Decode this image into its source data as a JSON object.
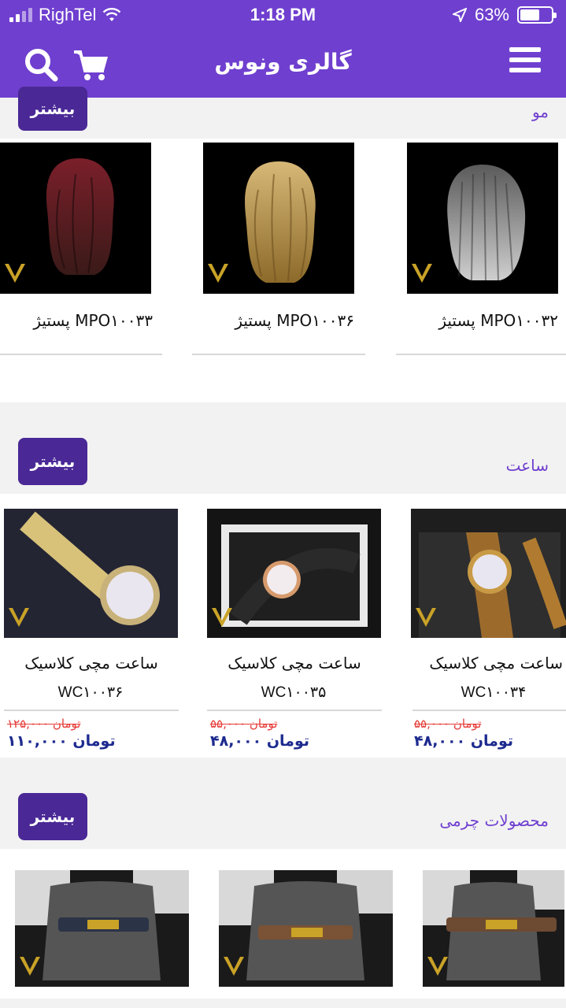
{
  "status_bar": {
    "carrier": "RighTel",
    "time": "1:18 PM",
    "battery": "63%",
    "battery_level": 0.63
  },
  "header": {
    "title": "گالری ونوس"
  },
  "sections": [
    {
      "title": "مو",
      "more_label": "بیشتر",
      "products": [
        {
          "name": "پستیژ   MPO۱۰۰۳۲"
        },
        {
          "name": "پستیژ   MPO۱۰۰۳۶"
        },
        {
          "name": "پستیژ   MPO۱۰۰۳۳"
        }
      ]
    },
    {
      "title": "ساعت",
      "more_label": "بیشتر",
      "products": [
        {
          "name": "ساعت مچی کلاسیک",
          "code": "WC۱۰۰۳۴",
          "old_price": "۵۵,۰۰۰ تومان",
          "price": "۴۸,۰۰۰ تومان"
        },
        {
          "name": "ساعت مچی کلاسیک",
          "code": "WC۱۰۰۳۵",
          "old_price": "۵۵,۰۰۰ تومان",
          "price": "۴۸,۰۰۰ تومان"
        },
        {
          "name": "ساعت مچی کلاسیک",
          "code": "WC۱۰۰۳۶",
          "old_price": "۱۲۵,۰۰۰ تومان",
          "price": "۱۱۰,۰۰۰ تومان"
        }
      ]
    },
    {
      "title": "محصولات چرمی",
      "more_label": "بیشتر",
      "products": [
        {},
        {},
        {}
      ]
    }
  ],
  "colors": {
    "primary": "#6f3fcf",
    "button": "#4a2896",
    "old_price": "#e53935",
    "price": "#1d2a8f"
  },
  "icons": [
    "search-icon",
    "cart-icon",
    "menu-icon",
    "venus-logo"
  ]
}
